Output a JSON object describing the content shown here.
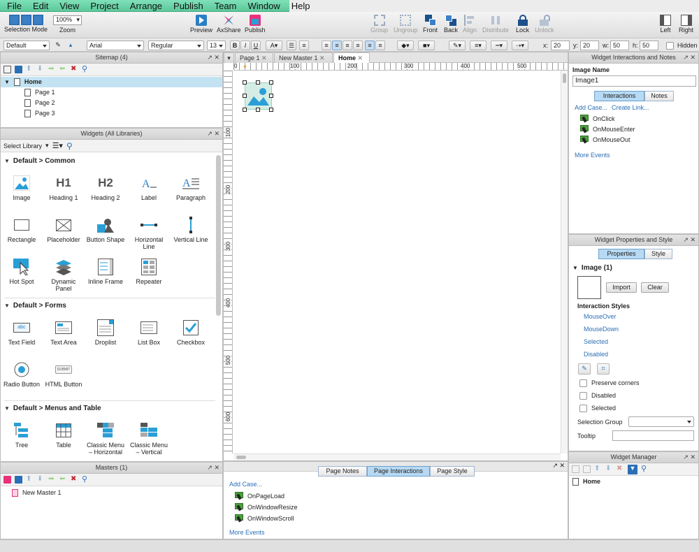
{
  "menu": [
    "File",
    "Edit",
    "View",
    "Project",
    "Arrange",
    "Publish",
    "Team",
    "Window",
    "Help"
  ],
  "toolbar": {
    "selection_mode": "Selection Mode",
    "zoom_label": "Zoom",
    "zoom_value": "100%",
    "preview": "Preview",
    "axshare": "AxShare",
    "publish": "Publish",
    "group": "Group",
    "ungroup": "Ungroup",
    "front": "Front",
    "back": "Back",
    "align": "Align",
    "distribute": "Distribute",
    "lock": "Lock",
    "unlock": "Unlock",
    "left": "Left",
    "right": "Right"
  },
  "format": {
    "style": "Default",
    "font": "Arial",
    "weight": "Regular",
    "size": "13",
    "bold": "B",
    "italic": "I",
    "underline": "U",
    "x_label": "x:",
    "x": "20",
    "y_label": "y:",
    "y": "20",
    "w_label": "w:",
    "w": "50",
    "h_label": "h:",
    "h": "50",
    "hidden": "Hidden"
  },
  "sitemap": {
    "title": "Sitemap (4)",
    "home": "Home",
    "pages": [
      "Page 1",
      "Page 2",
      "Page 3"
    ]
  },
  "widgets": {
    "title": "Widgets (All Libraries)",
    "select_library": "Select Library",
    "common_header": "Default > Common",
    "common": [
      "Image",
      "Heading 1",
      "Heading 2",
      "Label",
      "Paragraph",
      "Rectangle",
      "Placeholder",
      "Button Shape",
      "Horizontal Line",
      "Vertical Line",
      "Hot Spot",
      "Dynamic Panel",
      "Inline Frame",
      "Repeater"
    ],
    "h1_glyph": "H1",
    "h2_glyph": "H2",
    "forms_header": "Default > Forms",
    "forms": [
      "Text Field",
      "Text Area",
      "Droplist",
      "List Box",
      "Checkbox",
      "Radio Button",
      "HTML Button"
    ],
    "abc": "abc",
    "submit": "SUBMIT",
    "menus_header": "Default > Menus and Table",
    "menus": [
      "Tree",
      "Table",
      "Classic Menu – Horizontal",
      "Classic Menu – Vertical"
    ]
  },
  "masters": {
    "title": "Masters (1)",
    "items": [
      "New Master 1"
    ]
  },
  "tabs": [
    "Page 1",
    "New Master 1",
    "Home"
  ],
  "ruler": {
    "h": [
      "0",
      "100",
      "200",
      "300",
      "400",
      "500"
    ],
    "v": [
      "100",
      "200",
      "300",
      "400",
      "500",
      "600"
    ]
  },
  "bottom": {
    "tabs": [
      "Page Notes",
      "Page Interactions",
      "Page Style"
    ],
    "add_case": "Add Case...",
    "events": [
      "OnPageLoad",
      "OnWindowResize",
      "OnWindowScroll"
    ],
    "more_events": "More Events"
  },
  "interactions": {
    "title": "Widget Interactions and Notes",
    "image_name_label": "Image Name",
    "image_name": "Image1",
    "tab_interactions": "Interactions",
    "tab_notes": "Notes",
    "add_case": "Add Case...",
    "create_link": "Create Link...",
    "events": [
      "OnClick",
      "OnMouseEnter",
      "OnMouseOut"
    ],
    "more_events": "More Events"
  },
  "properties": {
    "title": "Widget Properties and Style",
    "tab_properties": "Properties",
    "tab_style": "Style",
    "section": "Image (1)",
    "import": "Import",
    "clear": "Clear",
    "interaction_styles": "Interaction Styles",
    "styles": [
      "MouseOver",
      "MouseDown",
      "Selected",
      "Disabled"
    ],
    "checks": [
      "Preserve corners",
      "Disabled",
      "Selected"
    ],
    "selection_group": "Selection Group",
    "tooltip": "Tooltip"
  },
  "manager": {
    "title": "Widget Manager",
    "item": "Home"
  },
  "colors": {
    "accent": "#2a9fd6",
    "link": "#2a6fb5",
    "menubar": "#6dd4a8"
  }
}
